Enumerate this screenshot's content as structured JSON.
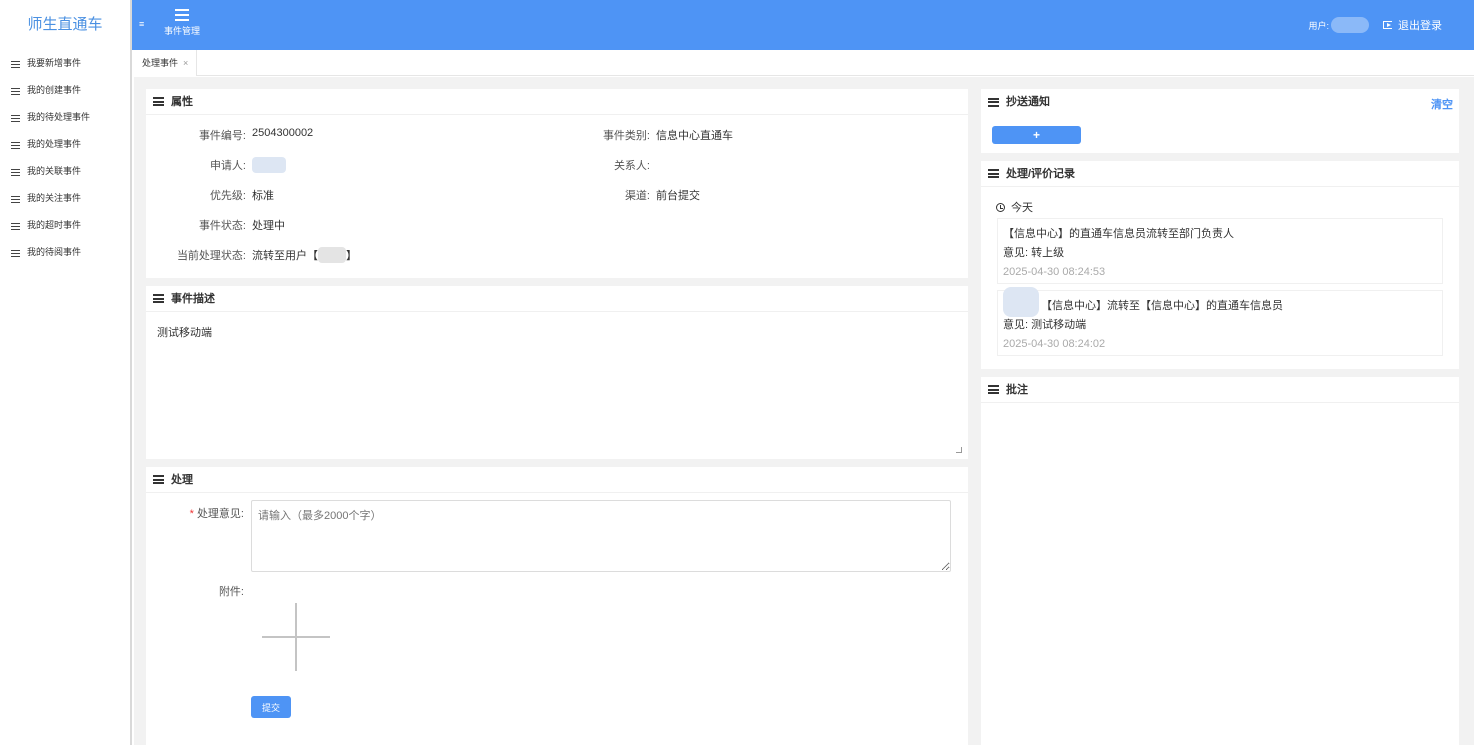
{
  "sidebar": {
    "brand": "师生直通车",
    "items": [
      {
        "label": "我要新增事件"
      },
      {
        "label": "我的创建事件"
      },
      {
        "label": "我的待处理事件"
      },
      {
        "label": "我的处理事件"
      },
      {
        "label": "我的关联事件"
      },
      {
        "label": "我的关注事件"
      },
      {
        "label": "我的超时事件"
      },
      {
        "label": "我的待阅事件"
      }
    ]
  },
  "header": {
    "mini_toggle": "≡",
    "menu_label": "事件管理",
    "user_label": "用户:",
    "logout_label": "退出登录"
  },
  "tabs": [
    {
      "label": "处理事件",
      "close": "×"
    }
  ],
  "properties": {
    "title": "属性",
    "event_no_label": "事件编号:",
    "event_no": "2504300002",
    "category_label": "事件类别:",
    "category": "信息中心直通车",
    "applicant_label": "申请人:",
    "contact_label": "关系人:",
    "priority_label": "优先级:",
    "priority": "标准",
    "channel_label": "渠道:",
    "channel": "前台提交",
    "status_label": "事件状态:",
    "status": "处理中",
    "current_label": "当前处理状态:",
    "current_prefix": "流转至用户【",
    "current_suffix": "】"
  },
  "description": {
    "title": "事件描述",
    "text": "测试移动端"
  },
  "handle": {
    "title": "处理",
    "required_mark": "*",
    "opinion_label": "处理意见:",
    "opinion_placeholder": "请输入（最多2000个字）",
    "attachment_label": "附件:",
    "submit_label": "提交"
  },
  "cc": {
    "title": "抄送通知",
    "clear_label": "清空",
    "add_label": "+"
  },
  "records": {
    "title": "处理/评价记录",
    "day_label": "今天",
    "items": [
      {
        "text": "【信息中心】的直通车信息员流转至部门负责人",
        "opinion": "意见: 转上级",
        "time": "2025-04-30 08:24:53"
      },
      {
        "text": "【信息中心】流转至【信息中心】的直通车信息员",
        "opinion": "意见: 测试移动端",
        "time": "2025-04-30 08:24:02"
      }
    ]
  },
  "annotation": {
    "title": "批注"
  }
}
